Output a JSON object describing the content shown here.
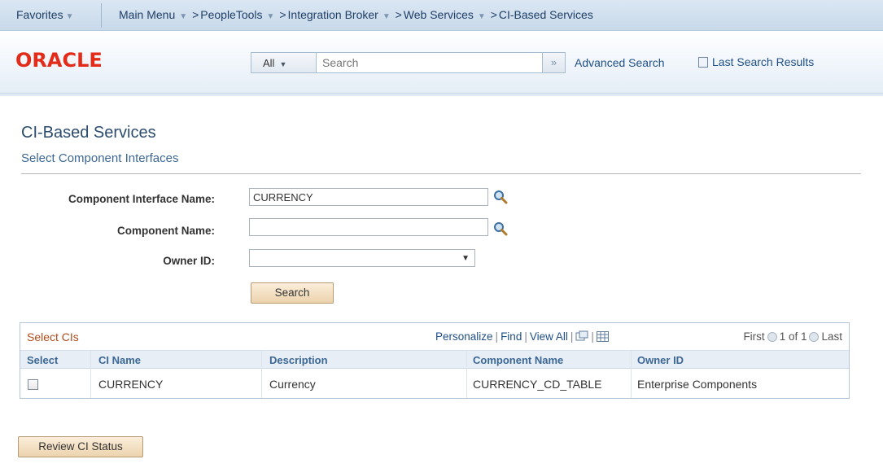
{
  "navbar": {
    "favorites": "Favorites",
    "main_menu": "Main Menu",
    "crumbs": [
      "PeopleTools",
      "Integration Broker",
      "Web Services",
      "CI-Based Services"
    ]
  },
  "header": {
    "logo": "ORACLE",
    "search_scope": "All",
    "search_placeholder": "Search",
    "advanced_search": "Advanced Search",
    "last_search_results": "Last Search Results"
  },
  "page": {
    "title": "CI-Based Services",
    "subtitle": "Select Component Interfaces"
  },
  "form": {
    "ci_name_label": "Component Interface Name:",
    "ci_name_value": "CURRENCY",
    "component_name_label": "Component Name:",
    "component_name_value": "",
    "owner_id_label": "Owner ID:",
    "owner_id_value": "",
    "search_button": "Search"
  },
  "grid": {
    "title": "Select CIs",
    "personalize": "Personalize",
    "find": "Find",
    "view_all": "View All",
    "first": "First",
    "range": "1 of 1",
    "last": "Last",
    "columns": [
      "Select",
      "CI Name",
      "Description",
      "Component Name",
      "Owner ID"
    ],
    "rows": [
      {
        "ci_name": "CURRENCY",
        "description": "Currency",
        "component_name": "CURRENCY_CD_TABLE",
        "owner_id": "Enterprise Components",
        "selected": false
      }
    ]
  },
  "footer": {
    "review_button": "Review CI Status"
  }
}
